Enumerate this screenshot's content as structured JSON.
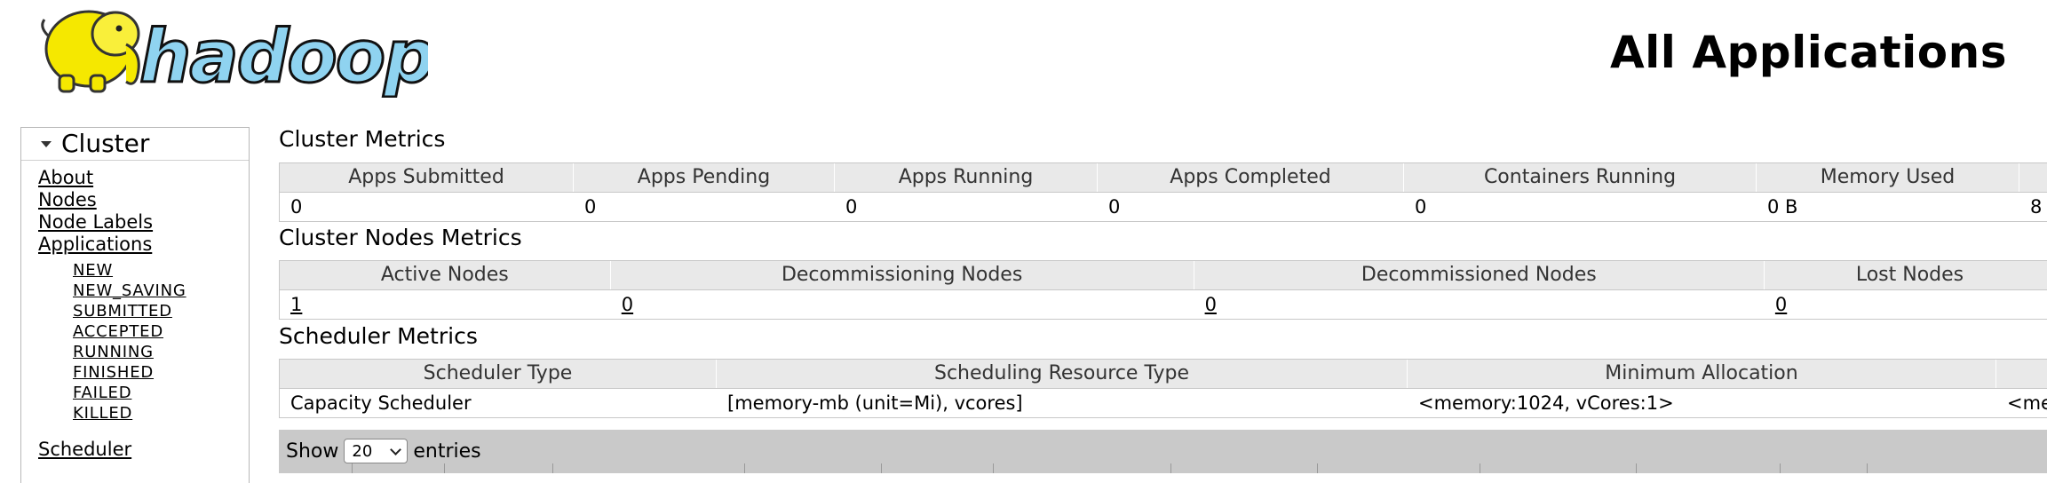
{
  "header": {
    "logo_text": "hadoop",
    "title": "All Applications"
  },
  "sidebar": {
    "title": "Cluster",
    "links": [
      "About",
      "Nodes",
      "Node Labels",
      "Applications"
    ],
    "app_states": [
      "NEW",
      "NEW_SAVING",
      "SUBMITTED",
      "ACCEPTED",
      "RUNNING",
      "FINISHED",
      "FAILED",
      "KILLED"
    ],
    "scheduler": "Scheduler"
  },
  "cluster_metrics": {
    "title": "Cluster Metrics",
    "headers": [
      "Apps Submitted",
      "Apps Pending",
      "Apps Running",
      "Apps Completed",
      "Containers Running",
      "Memory Used",
      ""
    ],
    "values": [
      "0",
      "0",
      "0",
      "0",
      "0",
      "0 B",
      "8"
    ]
  },
  "nodes_metrics": {
    "title": "Cluster Nodes Metrics",
    "headers": [
      "Active Nodes",
      "Decommissioning Nodes",
      "Decommissioned Nodes",
      "Lost Nodes"
    ],
    "values": [
      "1",
      "0",
      "0",
      "0"
    ]
  },
  "scheduler_metrics": {
    "title": "Scheduler Metrics",
    "headers": [
      "Scheduler Type",
      "Scheduling Resource Type",
      "Minimum Allocation",
      ""
    ],
    "values": [
      "Capacity Scheduler",
      "[memory-mb (unit=Mi), vcores]",
      "<memory:1024, vCores:1>",
      "<me"
    ]
  },
  "table_controls": {
    "show_label": "Show",
    "page_size": "20",
    "entries_label": "entries"
  }
}
